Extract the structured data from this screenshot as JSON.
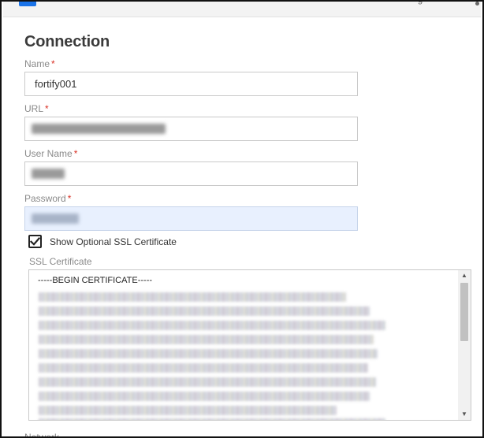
{
  "topbar": {
    "fragment_text": "g"
  },
  "section": {
    "title": "Connection"
  },
  "fields": {
    "name": {
      "label": "Name",
      "required_mark": "*",
      "value": "fortify001"
    },
    "url": {
      "label": "URL",
      "required_mark": "*"
    },
    "username": {
      "label": "User Name",
      "required_mark": "*"
    },
    "password": {
      "label": "Password",
      "required_mark": "*"
    }
  },
  "ssl": {
    "checkbox_label": "Show Optional SSL Certificate",
    "checked": true,
    "textarea_label": "SSL Certificate",
    "first_line": "-----BEGIN CERTIFICATE-----"
  },
  "next_section": {
    "label": "Network"
  },
  "colors": {
    "required": "#d93025",
    "autofill_bg": "#e8f0fe",
    "brand_blue": "#1a73e8"
  },
  "icons": {
    "checkbox": "check-icon",
    "scroll_up": "triangle-up-icon",
    "scroll_down": "triangle-down-icon"
  }
}
